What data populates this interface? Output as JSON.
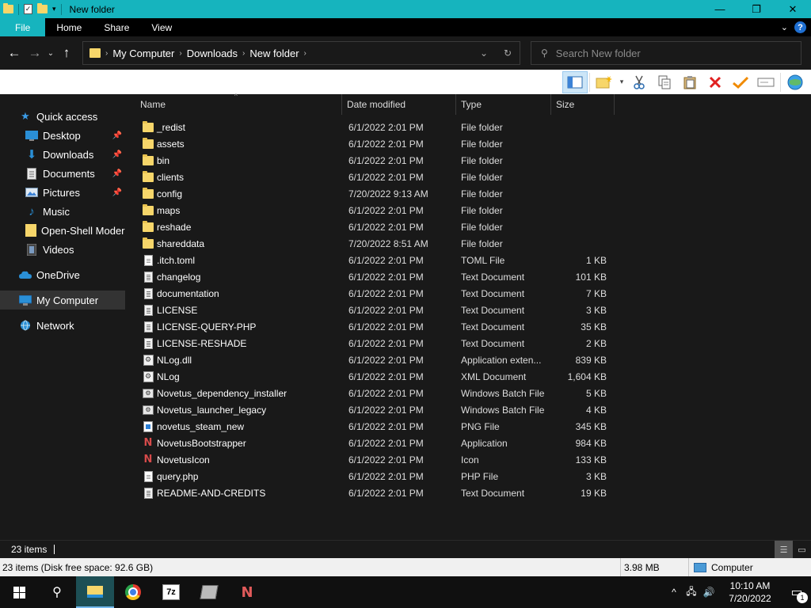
{
  "window": {
    "title": "New folder",
    "controls": {
      "minimize": "—",
      "maximize": "❐",
      "close": "✕"
    }
  },
  "ribbon": {
    "tabs": [
      "File",
      "Home",
      "Share",
      "View"
    ],
    "help": "?"
  },
  "address": {
    "breadcrumbs": [
      "My Computer",
      "Downloads",
      "New folder"
    ],
    "search_placeholder": "Search New folder"
  },
  "toolbar": {
    "buttons": [
      "navigation-pane",
      "new-folder",
      "cut",
      "copy",
      "paste",
      "delete",
      "properties",
      "rename",
      "internet"
    ]
  },
  "navpane": {
    "items": [
      {
        "label": "Quick access",
        "icon": "star-icon",
        "level": 1
      },
      {
        "label": "Desktop",
        "icon": "desktop-icon",
        "level": 2,
        "pinned": true
      },
      {
        "label": "Downloads",
        "icon": "download-icon",
        "level": 2,
        "pinned": true
      },
      {
        "label": "Documents",
        "icon": "documents-icon",
        "level": 2,
        "pinned": true
      },
      {
        "label": "Pictures",
        "icon": "pictures-icon",
        "level": 2,
        "pinned": true
      },
      {
        "label": "Music",
        "icon": "music-icon",
        "level": 2
      },
      {
        "label": "Open-Shell Modern",
        "icon": "folder-icon",
        "level": 2
      },
      {
        "label": "Videos",
        "icon": "videos-icon",
        "level": 2
      },
      {
        "label": "OneDrive",
        "icon": "cloud-icon",
        "level": 1
      },
      {
        "label": "My Computer",
        "icon": "computer-icon",
        "level": 1,
        "selected": true
      },
      {
        "label": "Network",
        "icon": "network-icon",
        "level": 1
      }
    ]
  },
  "filelist": {
    "columns": {
      "name": "Name",
      "date": "Date modified",
      "type": "Type",
      "size": "Size"
    },
    "rows": [
      {
        "name": "_redist",
        "date": "6/1/2022 2:01 PM",
        "type": "File folder",
        "size": "",
        "icon": "folder"
      },
      {
        "name": "assets",
        "date": "6/1/2022 2:01 PM",
        "type": "File folder",
        "size": "",
        "icon": "folder"
      },
      {
        "name": "bin",
        "date": "6/1/2022 2:01 PM",
        "type": "File folder",
        "size": "",
        "icon": "folder"
      },
      {
        "name": "clients",
        "date": "6/1/2022 2:01 PM",
        "type": "File folder",
        "size": "",
        "icon": "folder"
      },
      {
        "name": "config",
        "date": "7/20/2022 9:13 AM",
        "type": "File folder",
        "size": "",
        "icon": "folder"
      },
      {
        "name": "maps",
        "date": "6/1/2022 2:01 PM",
        "type": "File folder",
        "size": "",
        "icon": "folder"
      },
      {
        "name": "reshade",
        "date": "6/1/2022 2:01 PM",
        "type": "File folder",
        "size": "",
        "icon": "folder"
      },
      {
        "name": "shareddata",
        "date": "7/20/2022 8:51 AM",
        "type": "File folder",
        "size": "",
        "icon": "folder"
      },
      {
        "name": ".itch.toml",
        "date": "6/1/2022 2:01 PM",
        "type": "TOML File",
        "size": "1 KB",
        "icon": "doc"
      },
      {
        "name": "changelog",
        "date": "6/1/2022 2:01 PM",
        "type": "Text Document",
        "size": "101 KB",
        "icon": "text"
      },
      {
        "name": "documentation",
        "date": "6/1/2022 2:01 PM",
        "type": "Text Document",
        "size": "7 KB",
        "icon": "text"
      },
      {
        "name": "LICENSE",
        "date": "6/1/2022 2:01 PM",
        "type": "Text Document",
        "size": "3 KB",
        "icon": "text"
      },
      {
        "name": "LICENSE-QUERY-PHP",
        "date": "6/1/2022 2:01 PM",
        "type": "Text Document",
        "size": "35 KB",
        "icon": "text"
      },
      {
        "name": "LICENSE-RESHADE",
        "date": "6/1/2022 2:01 PM",
        "type": "Text Document",
        "size": "2 KB",
        "icon": "text"
      },
      {
        "name": "NLog.dll",
        "date": "6/1/2022 2:01 PM",
        "type": "Application exten...",
        "size": "839 KB",
        "icon": "gear"
      },
      {
        "name": "NLog",
        "date": "6/1/2022 2:01 PM",
        "type": "XML Document",
        "size": "1,604 KB",
        "icon": "gear"
      },
      {
        "name": "Novetus_dependency_installer",
        "date": "6/1/2022 2:01 PM",
        "type": "Windows Batch File",
        "size": "5 KB",
        "icon": "bat"
      },
      {
        "name": "Novetus_launcher_legacy",
        "date": "6/1/2022 2:01 PM",
        "type": "Windows Batch File",
        "size": "4 KB",
        "icon": "bat"
      },
      {
        "name": "novetus_steam_new",
        "date": "6/1/2022 2:01 PM",
        "type": "PNG File",
        "size": "345 KB",
        "icon": "png"
      },
      {
        "name": "NovetusBootstrapper",
        "date": "6/1/2022 2:01 PM",
        "type": "Application",
        "size": "984 KB",
        "icon": "novetus"
      },
      {
        "name": "NovetusIcon",
        "date": "6/1/2022 2:01 PM",
        "type": "Icon",
        "size": "133 KB",
        "icon": "novetus"
      },
      {
        "name": "query.php",
        "date": "6/1/2022 2:01 PM",
        "type": "PHP File",
        "size": "3 KB",
        "icon": "doc"
      },
      {
        "name": "README-AND-CREDITS",
        "date": "6/1/2022 2:01 PM",
        "type": "Text Document",
        "size": "19 KB",
        "icon": "text"
      }
    ]
  },
  "statusbar": {
    "item_count": "23 items"
  },
  "classic_status": {
    "summary": "23 items (Disk free space: 92.6 GB)",
    "size": "3.98 MB",
    "location": "Computer"
  },
  "taskbar": {
    "time": "10:10 AM",
    "date": "7/20/2022",
    "notifications": "1"
  }
}
